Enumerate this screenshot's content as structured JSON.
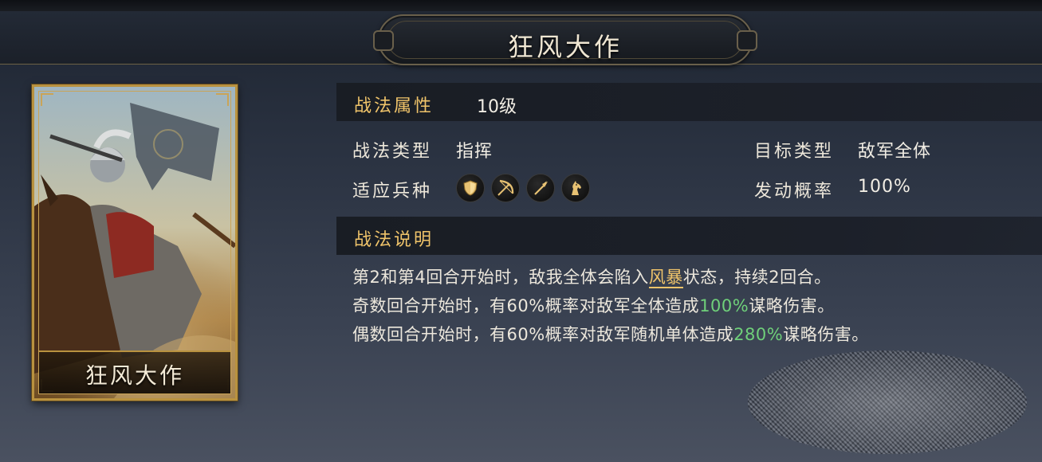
{
  "header": {
    "title": "狂风大作"
  },
  "card": {
    "name": "狂风大作"
  },
  "attributes": {
    "label": "战法属性",
    "level": "10级"
  },
  "rows": {
    "type_label": "战法类型",
    "type_value": "指挥",
    "target_label": "目标类型",
    "target_value": "敌军全体",
    "troop_label": "适应兵种",
    "troop_icons": [
      "shield-icon",
      "bow-icon",
      "spear-icon",
      "horse-icon"
    ],
    "rate_label": "发动概率",
    "rate_value": "100%"
  },
  "description": {
    "label": "战法说明",
    "line1": {
      "pre": "第2和第4回合开始时，敌我全体会陷入",
      "keyword": "风暴",
      "post": "状态，持续2回合。"
    },
    "line2": {
      "pre": "奇数回合开始时，有60%概率对敌军全体造成",
      "pct": "100%",
      "post": "谋略伤害。"
    },
    "line3": {
      "pre": "偶数回合开始时，有60%概率对敌军随机单体造成",
      "pct": "280%",
      "post": "谋略伤害。"
    }
  },
  "colors": {
    "gold": "#f0c46a",
    "green": "#6fd07a",
    "card_border": "#b9923f"
  }
}
